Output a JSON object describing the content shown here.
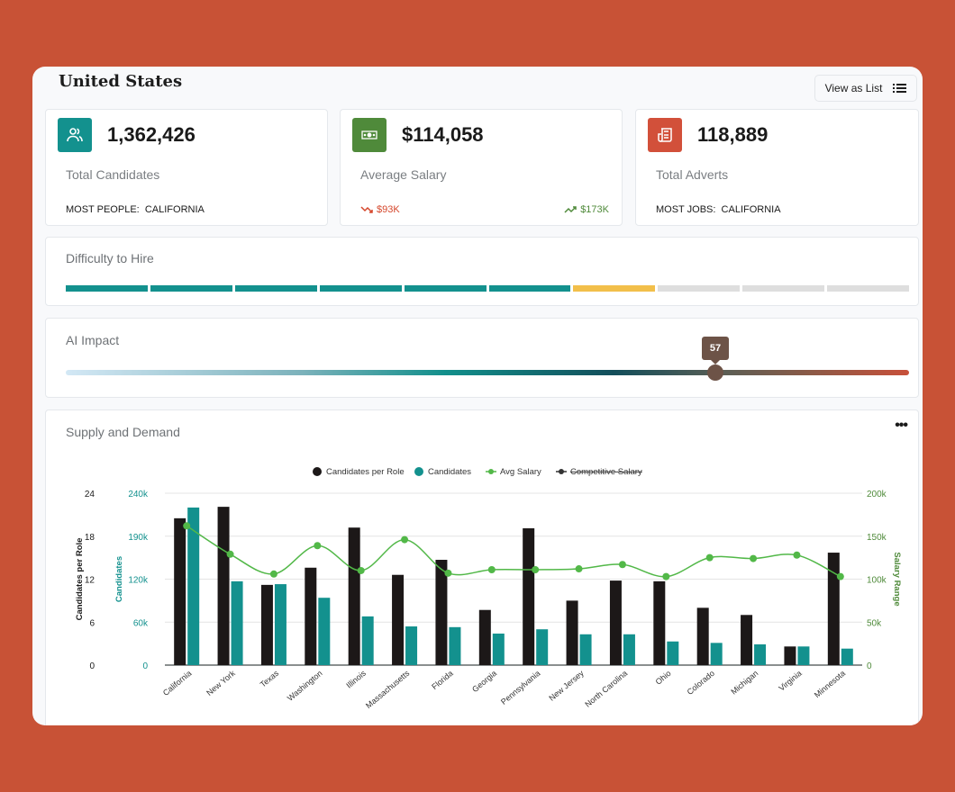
{
  "header": {
    "title": "United States",
    "view_as_list_label": "View as List"
  },
  "stats": [
    {
      "icon": "users-icon",
      "icon_color": "#13918e",
      "value": "1,362,426",
      "label": "Total Candidates",
      "footer_key": "MOST PEOPLE:",
      "footer_value": "CALIFORNIA"
    },
    {
      "icon": "cash-icon",
      "icon_color": "#4f8a3a",
      "value": "$114,058",
      "label": "Average Salary",
      "low": "$93K",
      "high": "$173K",
      "low_color": "#d5472c",
      "high_color": "#4f8a3a"
    },
    {
      "icon": "newspaper-icon",
      "icon_color": "#d2503a",
      "value": "118,889",
      "label": "Total Adverts",
      "footer_key": "MOST JOBS:",
      "footer_value": "CALIFORNIA"
    }
  ],
  "difficulty": {
    "title": "Difficulty to Hire",
    "segments_total": 10,
    "filled": 6,
    "current_index": 7,
    "colors": {
      "filled": "#13918e",
      "current": "#f2bf4a",
      "empty": "#dedede"
    }
  },
  "ai_impact": {
    "title": "AI Impact",
    "value": 57,
    "max": 74
  },
  "supply_demand": {
    "title": "Supply and Demand",
    "more_label": "•••"
  },
  "chart_data": {
    "type": "bar",
    "title": "Supply and Demand",
    "categories": [
      "California",
      "New York",
      "Texas",
      "Washington",
      "Illinois",
      "Massachusetts",
      "Florida",
      "Georgia",
      "Pennsylvania",
      "New Jersey",
      "North Carolina",
      "Ohio",
      "Colorado",
      "Michigan",
      "Virginia",
      "Minnesota"
    ],
    "legend": [
      {
        "name": "Candidates per Role",
        "color": "#1c1818",
        "marker": "circle"
      },
      {
        "name": "Candidates",
        "color": "#13918e",
        "marker": "circle"
      },
      {
        "name": "Avg Salary",
        "color": "#52b848",
        "marker": "line"
      },
      {
        "name": "Competitive Salary",
        "color": "#333333",
        "marker": "line",
        "hidden": true
      }
    ],
    "legend_position": "top-center",
    "series": [
      {
        "name": "Candidates per Role",
        "type": "bar",
        "axis": "left1",
        "values": [
          20.5,
          22.1,
          11.2,
          13.6,
          19.2,
          12.6,
          14.7,
          7.7,
          19.1,
          9.0,
          11.8,
          11.7,
          8.0,
          7.0,
          2.6,
          15.7
        ]
      },
      {
        "name": "Candidates",
        "type": "bar",
        "axis": "left2",
        "values": [
          220000,
          117000,
          113000,
          94000,
          68000,
          54000,
          53000,
          44000,
          50000,
          43000,
          43000,
          33000,
          31000,
          29000,
          26000,
          23000
        ]
      },
      {
        "name": "Avg Salary",
        "type": "line",
        "axis": "right",
        "values": [
          162000,
          129000,
          106000,
          139000,
          110000,
          146000,
          107000,
          111000,
          111000,
          112000,
          117000,
          103000,
          125000,
          124000,
          128000,
          103000
        ]
      }
    ],
    "axes": {
      "left1": {
        "label": "Candidates per Role",
        "ticks": [
          "0",
          "6",
          "12",
          "18",
          "24"
        ],
        "range": [
          0,
          24
        ],
        "color": "#1a1a1a"
      },
      "left2": {
        "label": "Candidates",
        "ticks": [
          "0",
          "60k",
          "120k",
          "190k",
          "240k"
        ],
        "range": [
          0,
          240000
        ],
        "color": "#13918e"
      },
      "right": {
        "label": "Salary Range",
        "ticks": [
          "0",
          "50k",
          "100k",
          "150k",
          "200k"
        ],
        "range": [
          0,
          200000
        ],
        "color": "#4f8a3a"
      }
    },
    "grid": true
  }
}
